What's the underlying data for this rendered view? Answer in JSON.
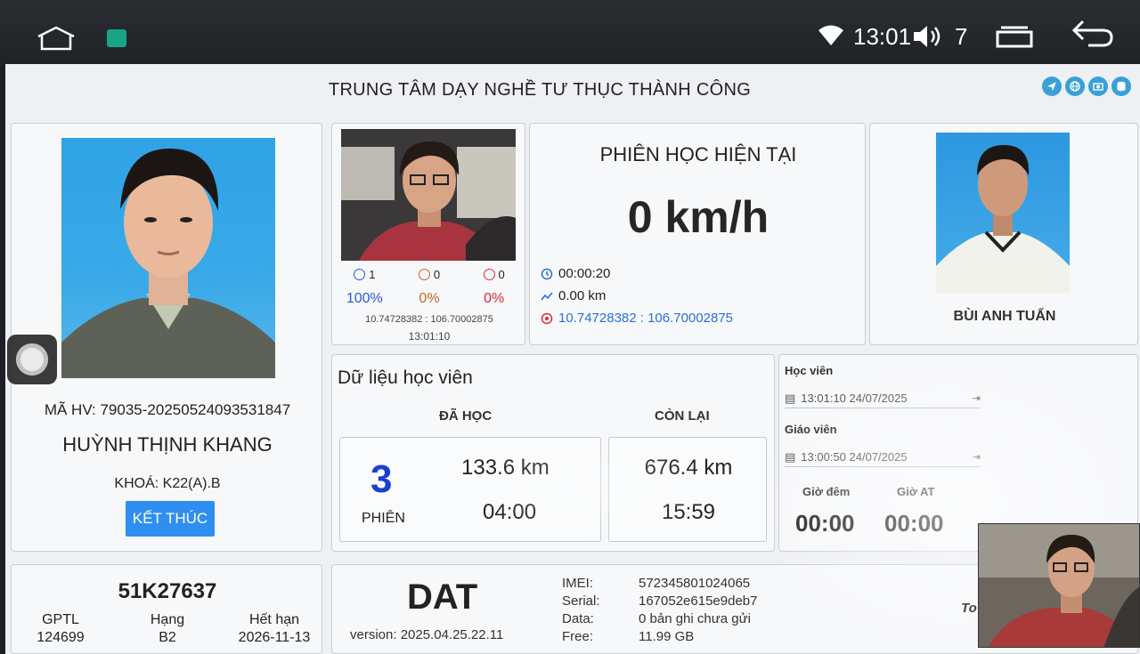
{
  "statusbar": {
    "time": "13:01",
    "volume_level": "7"
  },
  "header": {
    "title": "TRUNG TÂM DẠY NGHỀ TƯ THỤC THÀNH CÔNG"
  },
  "student": {
    "ma_hv_label": "MÃ HV: 79035-20250524093531847",
    "name": "HUỲNH THỊNH KHANG",
    "khoa": "KHOÁ: K22(A).B",
    "end_button": "KẾT THÚC"
  },
  "camera": {
    "emotions": [
      {
        "icon": "happy-face-icon",
        "count": "1",
        "color": "#2a59d8"
      },
      {
        "icon": "neutral-face-icon",
        "count": "0",
        "color": "#c9632a"
      },
      {
        "icon": "x-face-icon",
        "count": "0",
        "color": "#d82a3c"
      }
    ],
    "percents": [
      {
        "value": "100%",
        "color": "#2a59d8"
      },
      {
        "value": "0%",
        "color": "#c9632a"
      },
      {
        "value": "0%",
        "color": "#d82a3c"
      }
    ],
    "coords": "10.74728382 : 106.70002875",
    "timestamp": "13:01:10"
  },
  "session": {
    "title": "PHIÊN HỌC HIỆN TẠI",
    "speed": "0 km/h",
    "duration": "00:00:20",
    "distance": "0.00 km",
    "gps": "10.74728382 : 106.70002875"
  },
  "teacher": {
    "name": "BÙI ANH TUẤN"
  },
  "student_data": {
    "title": "Dữ liệu học viên",
    "da_hoc_header": "ĐÃ HỌC",
    "con_lai_header": "CÒN LẠI",
    "sessions_count": "3",
    "sessions_label": "PHIÊN",
    "learned_km": "133.6 km",
    "learned_time": "04:00",
    "remaining_km": "676.4 km",
    "remaining_time": "15:59"
  },
  "login_times": {
    "student_label": "Học viên",
    "student_time": "13:01:10 24/07/2025",
    "teacher_label": "Giáo viên",
    "teacher_time": "13:00:50 24/07/2025",
    "night_label": "Giờ đêm",
    "night_value": "00:00",
    "auto_label": "Giờ AT",
    "auto_value": "00:00"
  },
  "vehicle": {
    "plate": "51K27637",
    "gptl_label": "GPTL",
    "gptl_value": "124699",
    "hang_label": "Hạng",
    "hang_value": "B2",
    "het_han_label": "Hết hạn",
    "het_han_value": "2026-11-13"
  },
  "device": {
    "name": "DAT",
    "version": "version: 2025.04.25.22.11",
    "imei_label": "IMEI:",
    "imei_value": "572345801024065",
    "serial_label": "Serial:",
    "serial_value": "167052e615e9deb7",
    "data_label": "Data:",
    "data_value": "0 bản ghi chưa gửi",
    "free_label": "Free:",
    "free_value": "11.99 GB",
    "truncated_text": "To"
  },
  "colors": {
    "accent_blue": "#2f8ff0",
    "session_count_blue": "#1d3fd0",
    "gps_blue": "#2a6fd8"
  }
}
